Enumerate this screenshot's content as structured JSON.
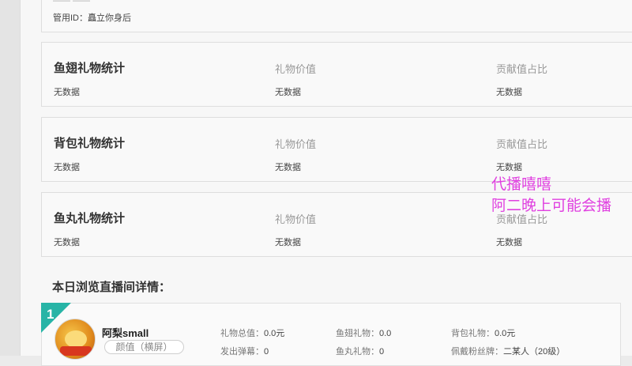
{
  "top_card": {
    "cut_text": "—— ——",
    "manager_label": "管用ID：",
    "manager_value": "矗立你身后"
  },
  "stats": [
    {
      "title": "鱼翅礼物统计",
      "col1": "礼物价值",
      "col2": "贡献值占比",
      "empty": "无数据"
    },
    {
      "title": "背包礼物统计",
      "col1": "礼物价值",
      "col2": "贡献值占比",
      "empty": "无数据"
    },
    {
      "title": "鱼丸礼物统计",
      "col1": "礼物价值",
      "col2": "贡献值占比",
      "empty": "无数据"
    }
  ],
  "room_section": {
    "title": "本日浏览直播间详情：",
    "rooms": [
      {
        "rank": "1",
        "name": "阿梨small",
        "category": "颜值（横屏）",
        "gift_total_label": "礼物总值：",
        "gift_total": "0.0元",
        "danmu_label": "发出弹幕：",
        "danmu": "0",
        "yuchi_label": "鱼翅礼物：",
        "yuchi": "0.0",
        "yuwan_label": "鱼丸礼物：",
        "yuwan": "0",
        "bag_label": "背包礼物：",
        "bag": "0.0元",
        "fan_label": "佩戴粉丝牌：",
        "fan": "二某人（20级）"
      }
    ]
  },
  "overlay": {
    "line1": "代播嘻嘻",
    "line2": "阿二晚上可能会播",
    "color": "#e040e0"
  }
}
